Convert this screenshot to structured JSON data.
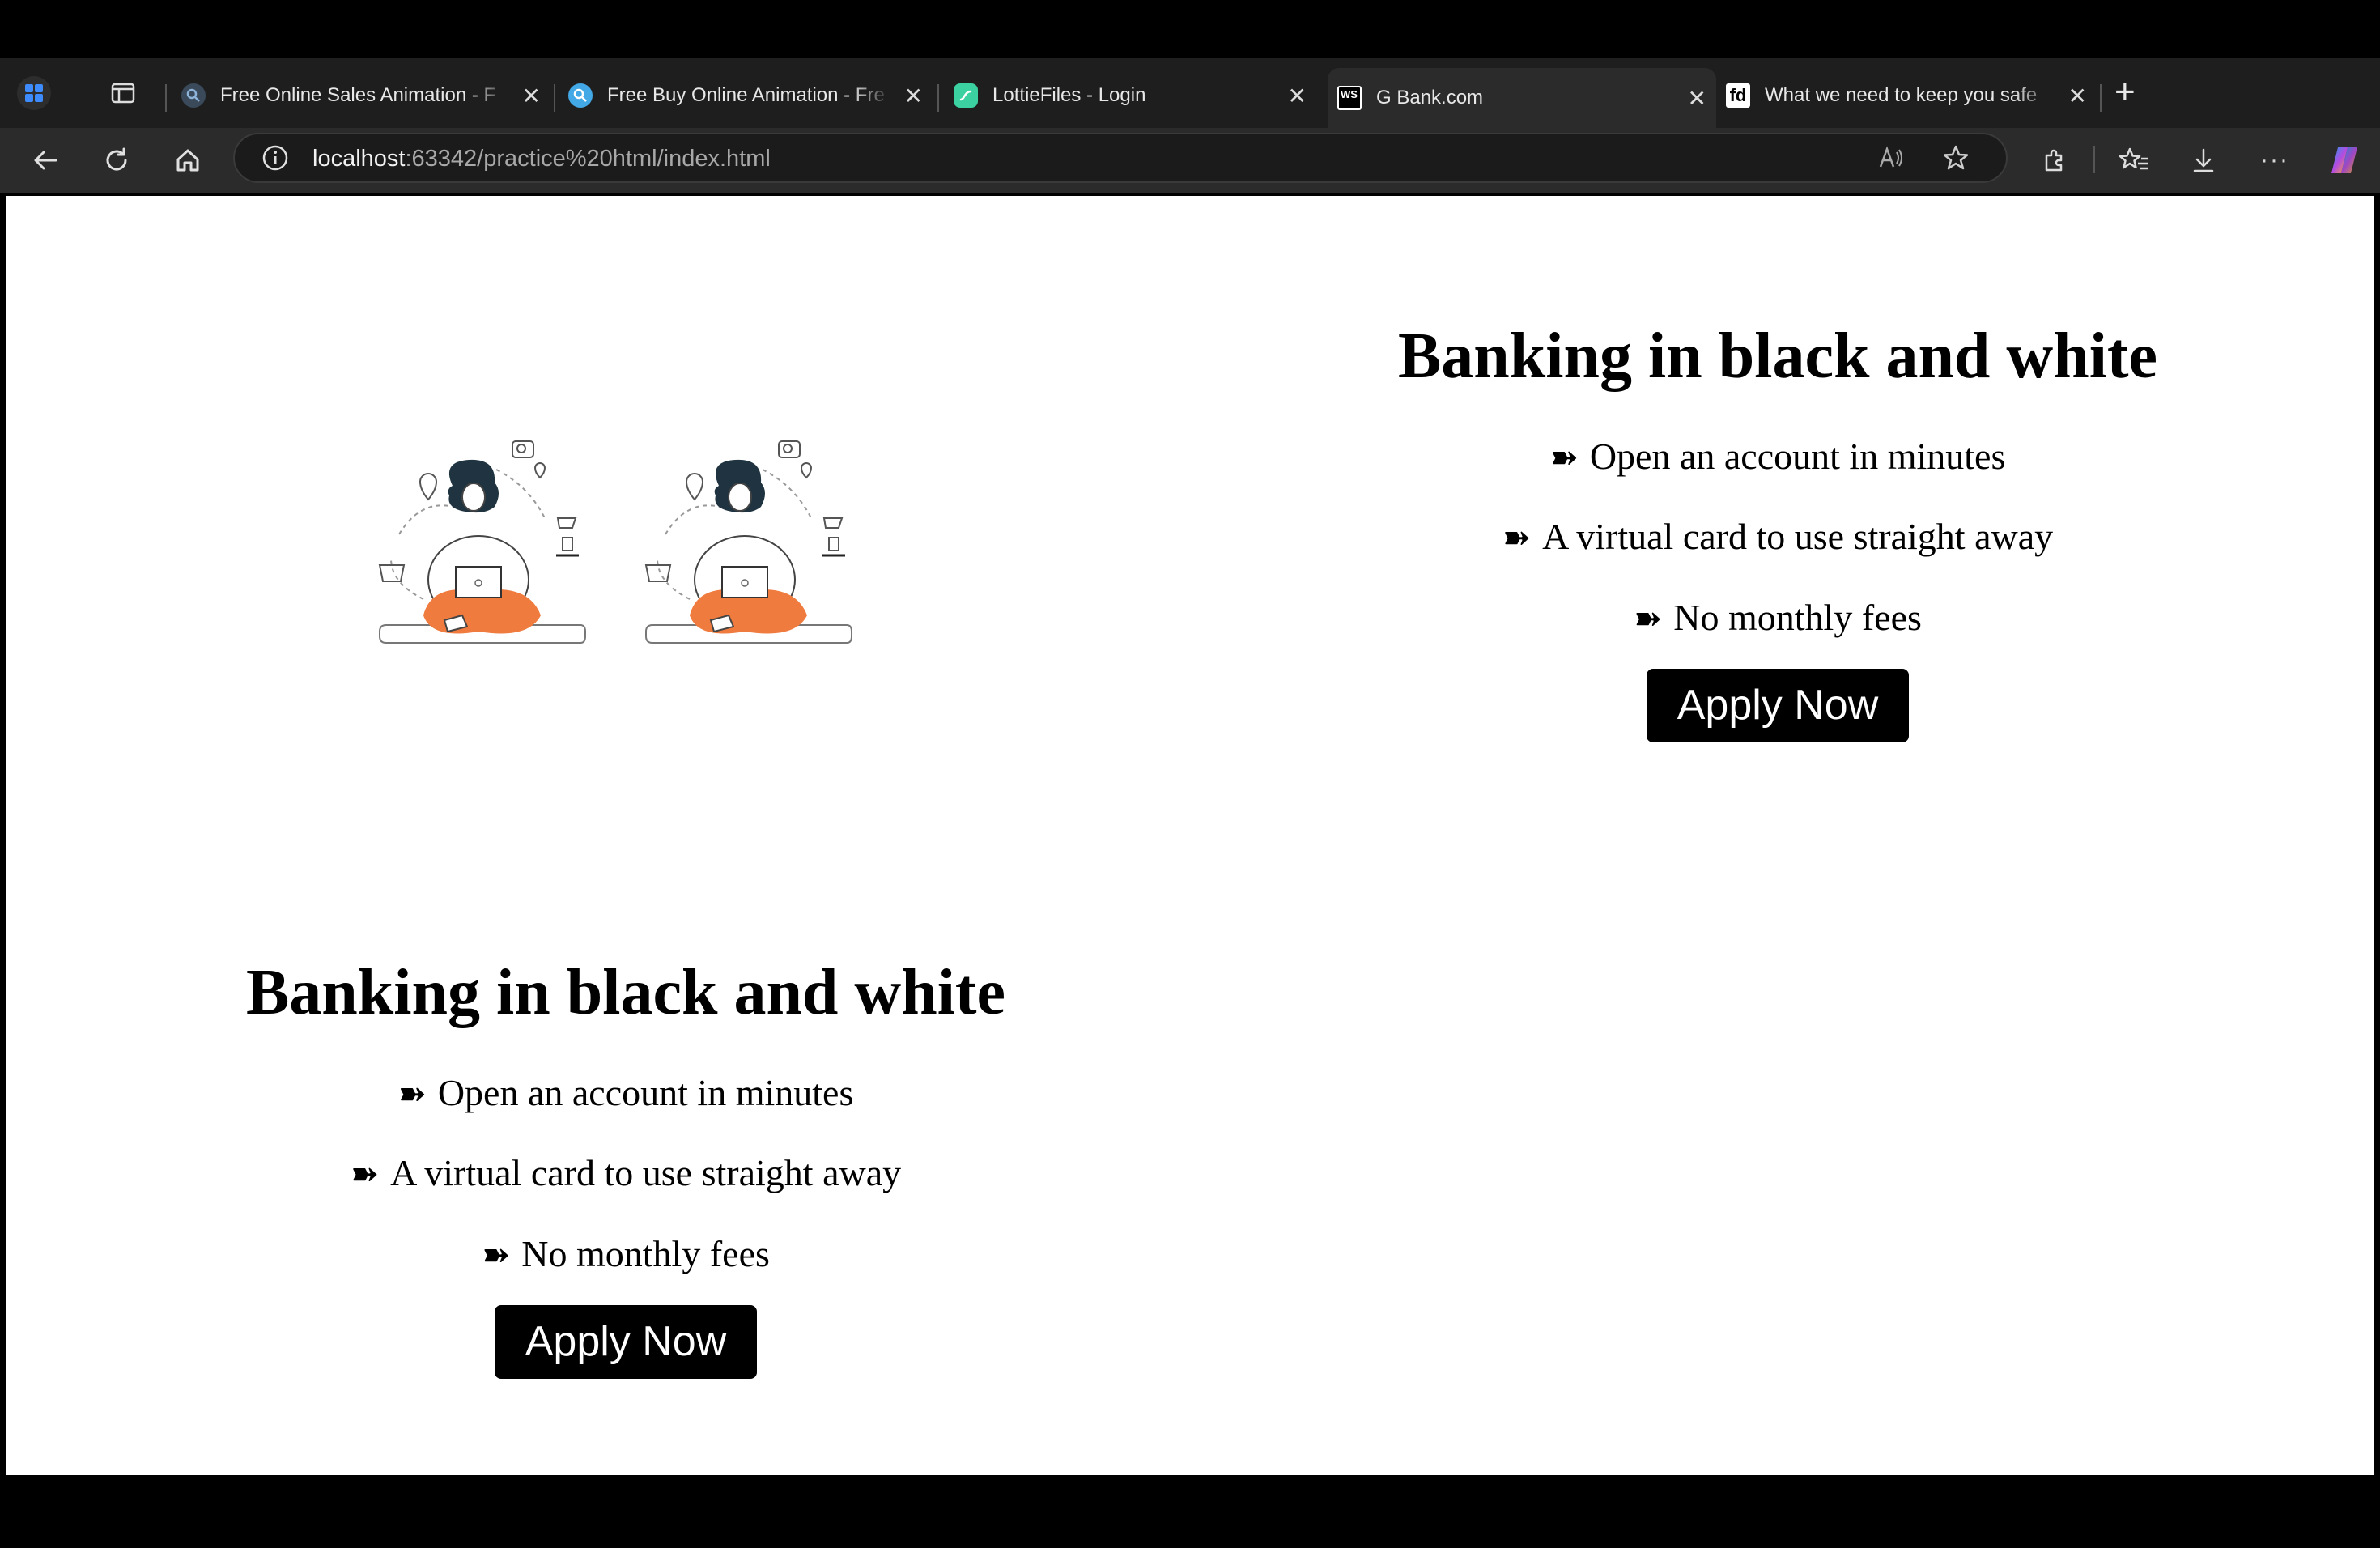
{
  "browser": {
    "tabs": [
      {
        "title": "Free Online Sales Animation - F",
        "icon": "search-globe-icon",
        "active": false
      },
      {
        "title": "Free Buy Online Animation - Fre",
        "icon": "search-globe-icon",
        "active": false
      },
      {
        "title": "LottieFiles - Login",
        "icon": "lottiefiles-icon",
        "active": false
      },
      {
        "title": "G Bank.com",
        "icon": "webstorm-icon",
        "active": true
      },
      {
        "title": "What we need to keep you safe",
        "icon": "fd-icon",
        "active": false
      }
    ],
    "tab_icon_labels": {
      "webstorm": "WS",
      "fd": "fd"
    },
    "address": {
      "host": "localhost",
      "path": ":63342/practice%20html/index.html"
    }
  },
  "page": {
    "sections": [
      {
        "heading": "Banking in black and white",
        "items": [
          "Open an account in minutes",
          "A virtual card to use straight away",
          "No monthly fees"
        ],
        "button": "Apply Now"
      },
      {
        "heading": "Banking in black and white",
        "items": [
          "Open an account in minutes",
          "A virtual card to use straight away",
          "No monthly fees"
        ],
        "button": "Apply Now"
      }
    ],
    "bullet_glyph": "➽",
    "illustration": "woman-with-laptop-illustration",
    "colors": {
      "accent_orange": "#f07b3f",
      "button_bg": "#000000",
      "button_text": "#ffffff"
    }
  }
}
